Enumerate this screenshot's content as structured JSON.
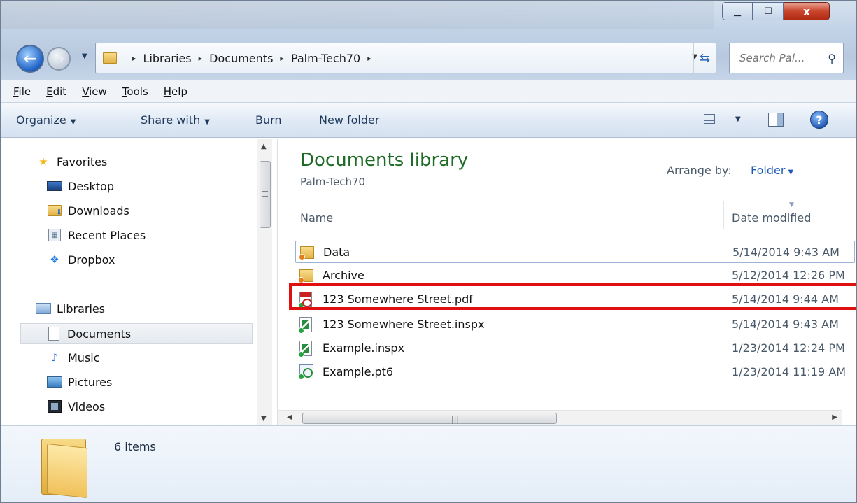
{
  "window": {
    "controls": {
      "minimize": "▁",
      "maximize": "☐",
      "close": "x"
    }
  },
  "address_bar": {
    "breadcrumbs": [
      "Libraries",
      "Documents",
      "Palm-Tech70"
    ],
    "separator": "▸"
  },
  "search": {
    "placeholder": "Search Pal..."
  },
  "menu": {
    "items": [
      {
        "accel": "F",
        "rest": "ile"
      },
      {
        "accel": "E",
        "rest": "dit"
      },
      {
        "accel": "V",
        "rest": "iew"
      },
      {
        "accel": "T",
        "rest": "ools"
      },
      {
        "accel": "H",
        "rest": "elp"
      }
    ]
  },
  "toolbar": {
    "organize": "Organize",
    "share_with": "Share with",
    "burn": "Burn",
    "new_folder": "New folder"
  },
  "nav": {
    "favorites": {
      "label": "Favorites",
      "items": [
        "Desktop",
        "Downloads",
        "Recent Places",
        "Dropbox"
      ]
    },
    "libraries": {
      "label": "Libraries",
      "items": [
        "Documents",
        "Music",
        "Pictures",
        "Videos"
      ],
      "selected": "Documents"
    }
  },
  "content": {
    "title": "Documents library",
    "subtitle": "Palm-Tech70",
    "arrange_by_label": "Arrange by:",
    "arrange_by_value": "Folder",
    "columns": {
      "name": "Name",
      "date": "Date modified"
    },
    "files": [
      {
        "name": "Data",
        "date": "5/14/2014 9:43 AM",
        "type": "folder",
        "icon": "folder-sync-icon"
      },
      {
        "name": "Archive",
        "date": "5/12/2014 12:26 PM",
        "type": "folder",
        "icon": "folder-sync-icon"
      },
      {
        "name": "123 Somewhere Street.pdf",
        "date": "5/14/2014 9:44 AM",
        "type": "pdf",
        "icon": "pdf-file-icon",
        "highlighted": true
      },
      {
        "name": "123 Somewhere Street.inspx",
        "date": "5/14/2014 9:43 AM",
        "type": "inspx",
        "icon": "inspx-file-icon"
      },
      {
        "name": "Example.inspx",
        "date": "1/23/2014 12:24 PM",
        "type": "inspx",
        "icon": "inspx-file-icon"
      },
      {
        "name": "Example.pt6",
        "date": "1/23/2014 11:19 AM",
        "type": "pt6",
        "icon": "pt6-file-icon"
      }
    ]
  },
  "details": {
    "item_count": "6 items"
  },
  "colors": {
    "highlight": "#e01010",
    "library_title": "#1d6b24",
    "link": "#1d5bb5"
  }
}
